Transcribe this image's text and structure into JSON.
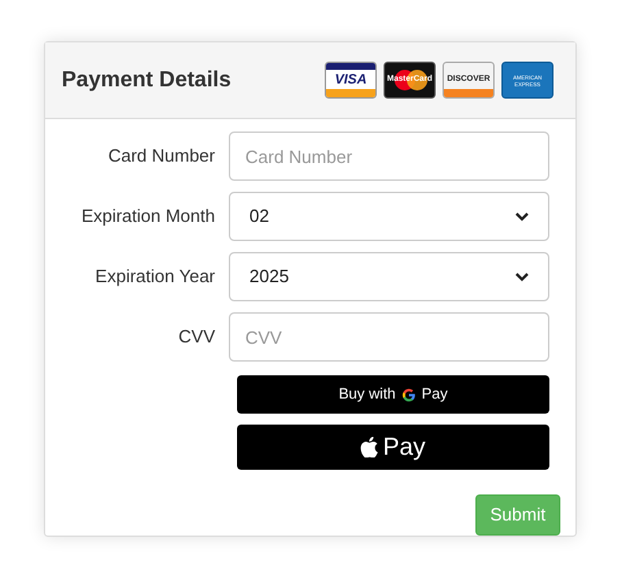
{
  "panel": {
    "title": "Payment Details"
  },
  "card_logos": [
    {
      "kind": "visa",
      "label": "VISA"
    },
    {
      "kind": "mastercard",
      "label": "MasterCard"
    },
    {
      "kind": "discover",
      "label": "DISCOVER"
    },
    {
      "kind": "amex",
      "label": "AMERICAN EXPRESS"
    }
  ],
  "fields": [
    {
      "kind": "input",
      "label": "Card Number",
      "placeholder": "Card Number"
    },
    {
      "kind": "select",
      "label": "Expiration Month",
      "value": "02"
    },
    {
      "kind": "select",
      "label": "Expiration Year",
      "value": "2025"
    },
    {
      "kind": "input",
      "label": "CVV",
      "placeholder": "CVV"
    }
  ],
  "wallet_buttons": [
    {
      "kind": "google",
      "prefix": "Buy with",
      "label": "Pay"
    },
    {
      "kind": "apple",
      "label": "Pay"
    }
  ],
  "submit": {
    "label": "Submit"
  }
}
